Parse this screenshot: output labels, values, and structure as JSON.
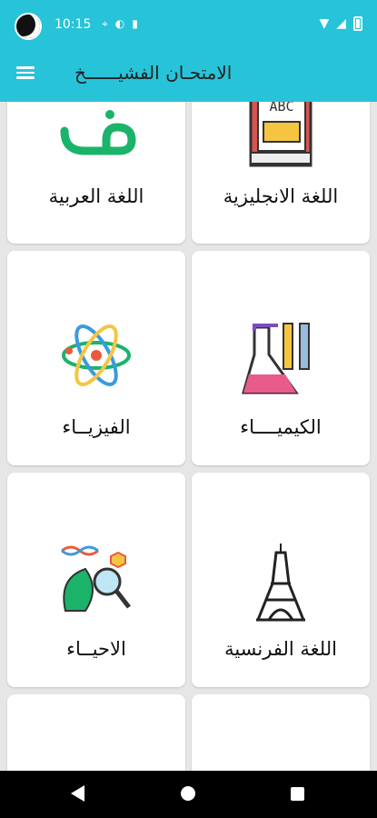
{
  "status_bar": {
    "time": "10:15"
  },
  "app_bar": {
    "title": "الامتحـان الفشيــــــخ",
    "menu_icon": "hamburger-menu-icon"
  },
  "subjects": [
    {
      "label": "اللغة العربية",
      "icon": "arabic-letter-icon",
      "color": "#1bb36a"
    },
    {
      "label": "اللغة الانجليزية",
      "icon": "english-book-icon"
    },
    {
      "label": "الفيزيــاء",
      "icon": "atom-icon"
    },
    {
      "label": "الكيميــــاء",
      "icon": "chemistry-flask-icon"
    },
    {
      "label": "الاحيــاء",
      "icon": "biology-icon"
    },
    {
      "label": "اللغة الفرنسية",
      "icon": "eiffel-tower-icon"
    }
  ],
  "colors": {
    "primary": "#27c3d8",
    "background": "#e6e6e6"
  }
}
